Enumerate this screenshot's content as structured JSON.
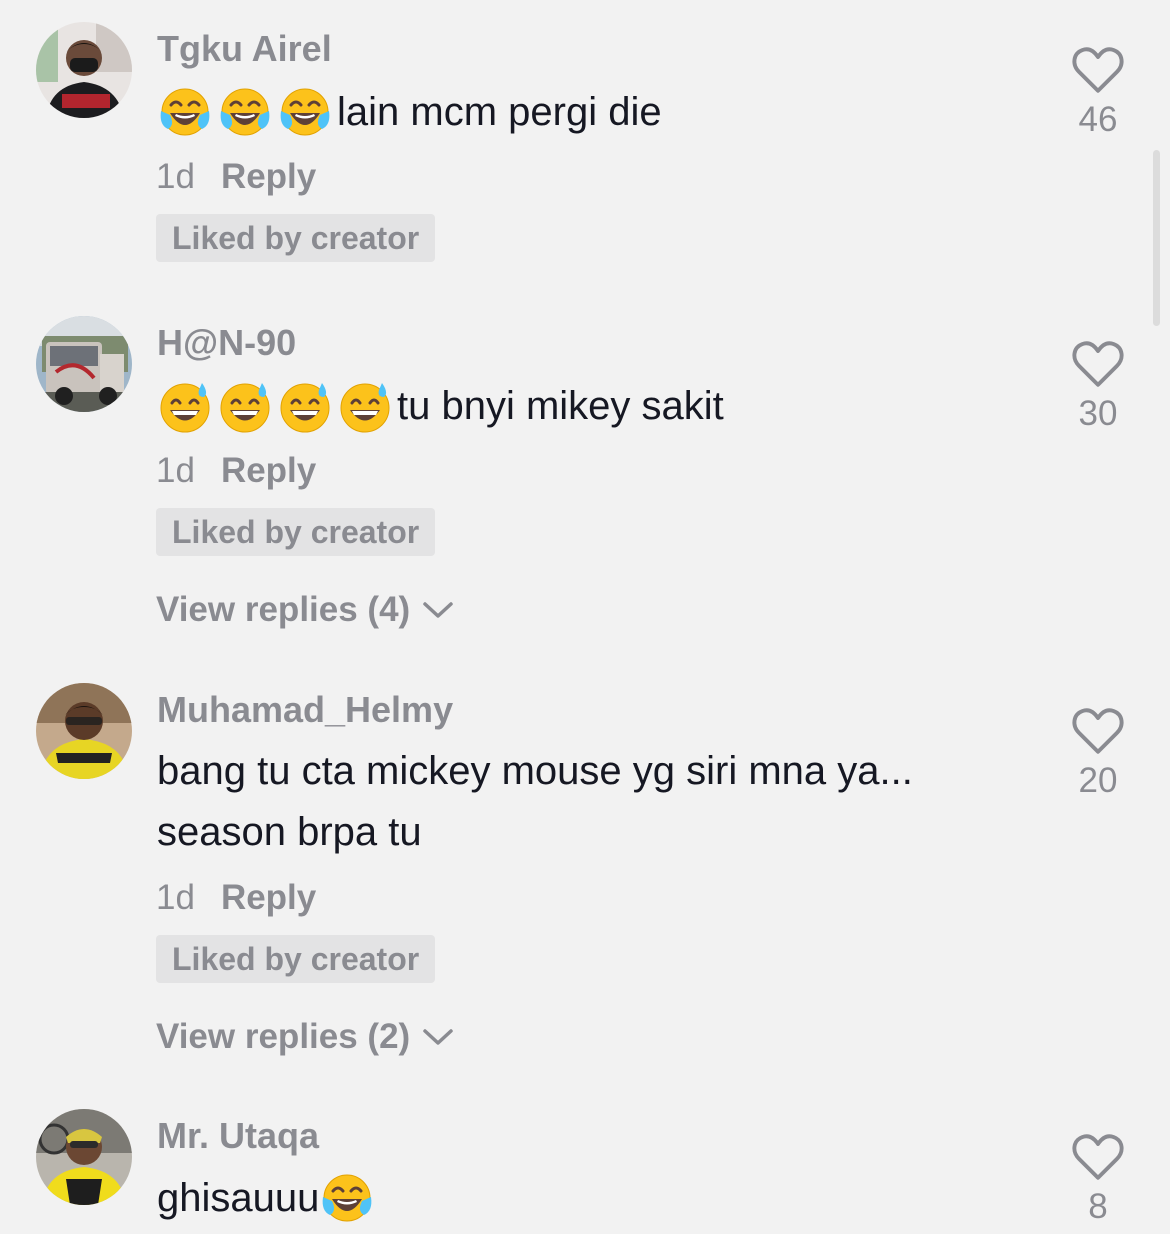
{
  "comments": [
    {
      "username": "Tgku Airel",
      "text": "lain mcm pergi die",
      "emojis": [
        "face-with-tears-of-joy",
        "face-with-tears-of-joy",
        "face-with-tears-of-joy"
      ],
      "time": "1d",
      "reply_label": "Reply",
      "badge": "Liked by creator",
      "likes": "46"
    },
    {
      "username": "H@N-90",
      "text": "tu bnyi mikey sakit",
      "emojis": [
        "grinning-face-with-sweat",
        "grinning-face-with-sweat",
        "grinning-face-with-sweat",
        "grinning-face-with-sweat"
      ],
      "time": "1d",
      "reply_label": "Reply",
      "badge": "Liked by creator",
      "view_replies": "View replies (4)",
      "likes": "30"
    },
    {
      "username": "Muhamad_Helmy",
      "text": "bang tu cta mickey mouse yg siri mna ya... season brpa tu",
      "time": "1d",
      "reply_label": "Reply",
      "badge": "Liked by creator",
      "view_replies": "View replies (2)",
      "likes": "20"
    },
    {
      "username": "Mr. Utaqa",
      "text": "ghisauuu",
      "emojis": [
        "face-with-tears-of-joy"
      ],
      "likes": "8"
    }
  ],
  "icons": {
    "like": "heart-outline-icon",
    "expand": "chevron-down-icon"
  },
  "colors": {
    "background": "#f2f2f2",
    "secondary_text": "#8a8b91",
    "primary_text": "#161823",
    "badge_bg": "#e3e3e4"
  }
}
